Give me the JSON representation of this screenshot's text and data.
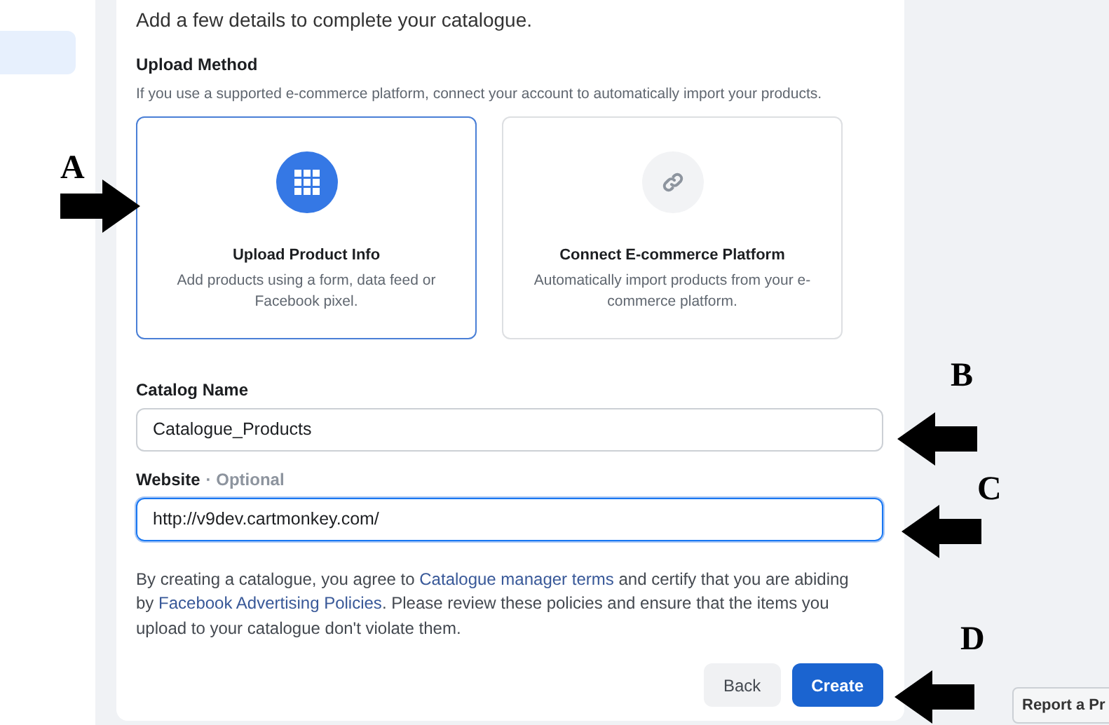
{
  "sidebar": {
    "items": [
      {
        "selected": true
      }
    ]
  },
  "intro": "Add a few details to complete your catalogue.",
  "upload_method": {
    "title": "Upload Method",
    "hint": "If you use a supported e-commerce platform, connect your account to automatically import your products.",
    "options": [
      {
        "kind": "grid",
        "title": "Upload Product Info",
        "description": "Add products using a form, data feed or Facebook pixel.",
        "selected": true
      },
      {
        "kind": "link",
        "title": "Connect E-commerce Platform",
        "description": "Automatically import products from your e-commerce platform.",
        "selected": false
      }
    ]
  },
  "fields": [
    {
      "label": "Catalog Name",
      "value": "Catalogue_Products",
      "focused": false
    },
    {
      "label": "Website",
      "optional": "· Optional",
      "value": "http://v9dev.cartmonkey.com/",
      "focused": true
    }
  ],
  "agreement": [
    {
      "kind": "text",
      "text": "By creating a catalogue, you agree to "
    },
    {
      "kind": "link",
      "text": "Catalogue manager terms"
    },
    {
      "kind": "text",
      "text": " and certify that you are abiding by "
    },
    {
      "kind": "link",
      "text": "Facebook Advertising Policies"
    },
    {
      "kind": "text",
      "text": ". Please review these policies and ensure that the items you upload to your catalogue don't violate them."
    }
  ],
  "buttons": [
    {
      "label": "Back",
      "kind": "secondary"
    },
    {
      "label": "Create",
      "kind": "primary"
    }
  ],
  "report_button": "Report a Pr",
  "annotations": [
    {
      "letter": "A",
      "kind": "right"
    },
    {
      "letter": "B",
      "kind": "left"
    },
    {
      "letter": "C",
      "kind": "left"
    },
    {
      "letter": "D",
      "kind": "left"
    }
  ]
}
